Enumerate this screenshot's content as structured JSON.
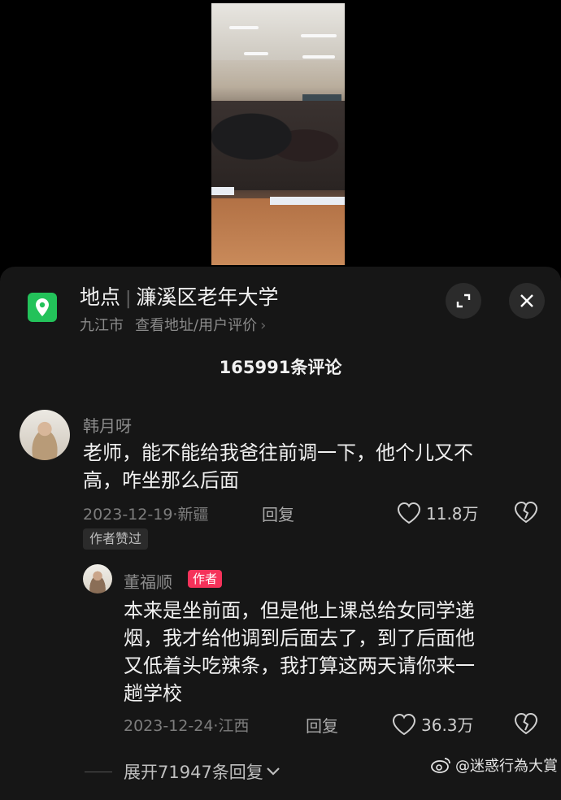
{
  "location": {
    "label": "地点",
    "name": "濂溪区老年大学",
    "city": "九江市",
    "view_link": "查看地址/用户评价",
    "arrow": "›"
  },
  "comments_header": {
    "title": "165991条评论"
  },
  "comments": [
    {
      "username": "韩月呀",
      "text_line1": "老师，能不能给我爸往前调一下，他个儿又不",
      "text_line2": "高，咋坐那么后面",
      "date": "2023-12-19",
      "region": "新疆",
      "reply_label": "回复",
      "likes": "11.8万",
      "badge": "作者赞过"
    }
  ],
  "reply": {
    "username": "董福顺",
    "author_tag": "作者",
    "text_line1": "本来是坐前面，但是他上课总给女同学递",
    "text_line2": "烟，我才给他调到后面去了，到了后面他",
    "text_line3": "又低着头吃辣条，我打算这两天请你来一",
    "text_line4": "趟学校",
    "date": "2023-12-24",
    "region": "江西",
    "reply_label": "回复",
    "likes": "36.3万"
  },
  "expand_replies": "展开71947条回复",
  "watermark": "@迷惑行為大賞",
  "colors": {
    "panel_bg": "#161616",
    "location_icon": "#23c25a",
    "author_tag": "#f5325a"
  }
}
